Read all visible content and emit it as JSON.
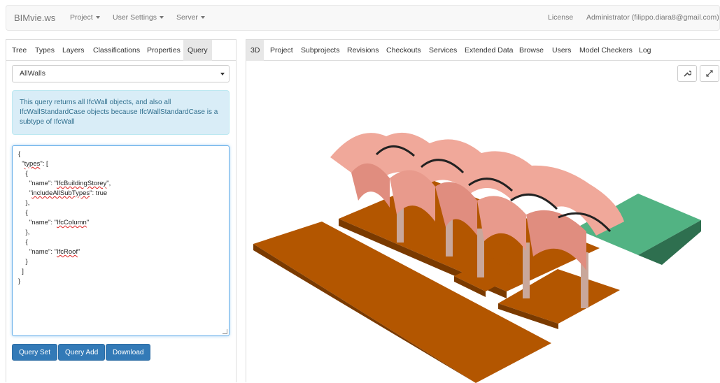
{
  "navbar": {
    "brand": "BIMvie.ws",
    "project": "Project",
    "user_settings": "User Settings",
    "server": "Server",
    "license": "License",
    "user": "Administrator (filippo.diara8@gmail.com)"
  },
  "left_tabs": [
    "Tree",
    "Types",
    "Layers",
    "Classifications",
    "Properties",
    "Query"
  ],
  "query": {
    "selected": "AllWalls",
    "info": "This query returns all IfcWall objects, and also all IfcWallStandardCase objects because IfcWallStandardCase is a subtype of IfcWall",
    "lines": [
      "{",
      "  \"types\": [",
      "    {",
      "      \"name\": \"IfcBuildingStorey\",",
      "      \"includeAllSubTypes\": true",
      "    },",
      "    {",
      "      \"name\": \"IfcColumn\"",
      "    },",
      "    {",
      "      \"name\": \"IfcRoof\"",
      "    }",
      "  ]",
      "}"
    ],
    "buttons": {
      "query_set": "Query Set",
      "query_add": "Query Add",
      "download": "Download"
    }
  },
  "right_tabs": [
    "3D",
    "Project",
    "Subprojects",
    "Revisions",
    "Checkouts",
    "Services",
    "Extended Data",
    "Browse",
    "Users",
    "Model Checkers",
    "Log"
  ],
  "colors": {
    "primary": "#337ab7",
    "slab": "#b35600",
    "vault": "#f0a89a",
    "green_slab": "#52b383",
    "info_bg": "#d9edf7"
  },
  "icons": {
    "settings": "wrench-icon",
    "fullscreen": "expand-icon"
  }
}
